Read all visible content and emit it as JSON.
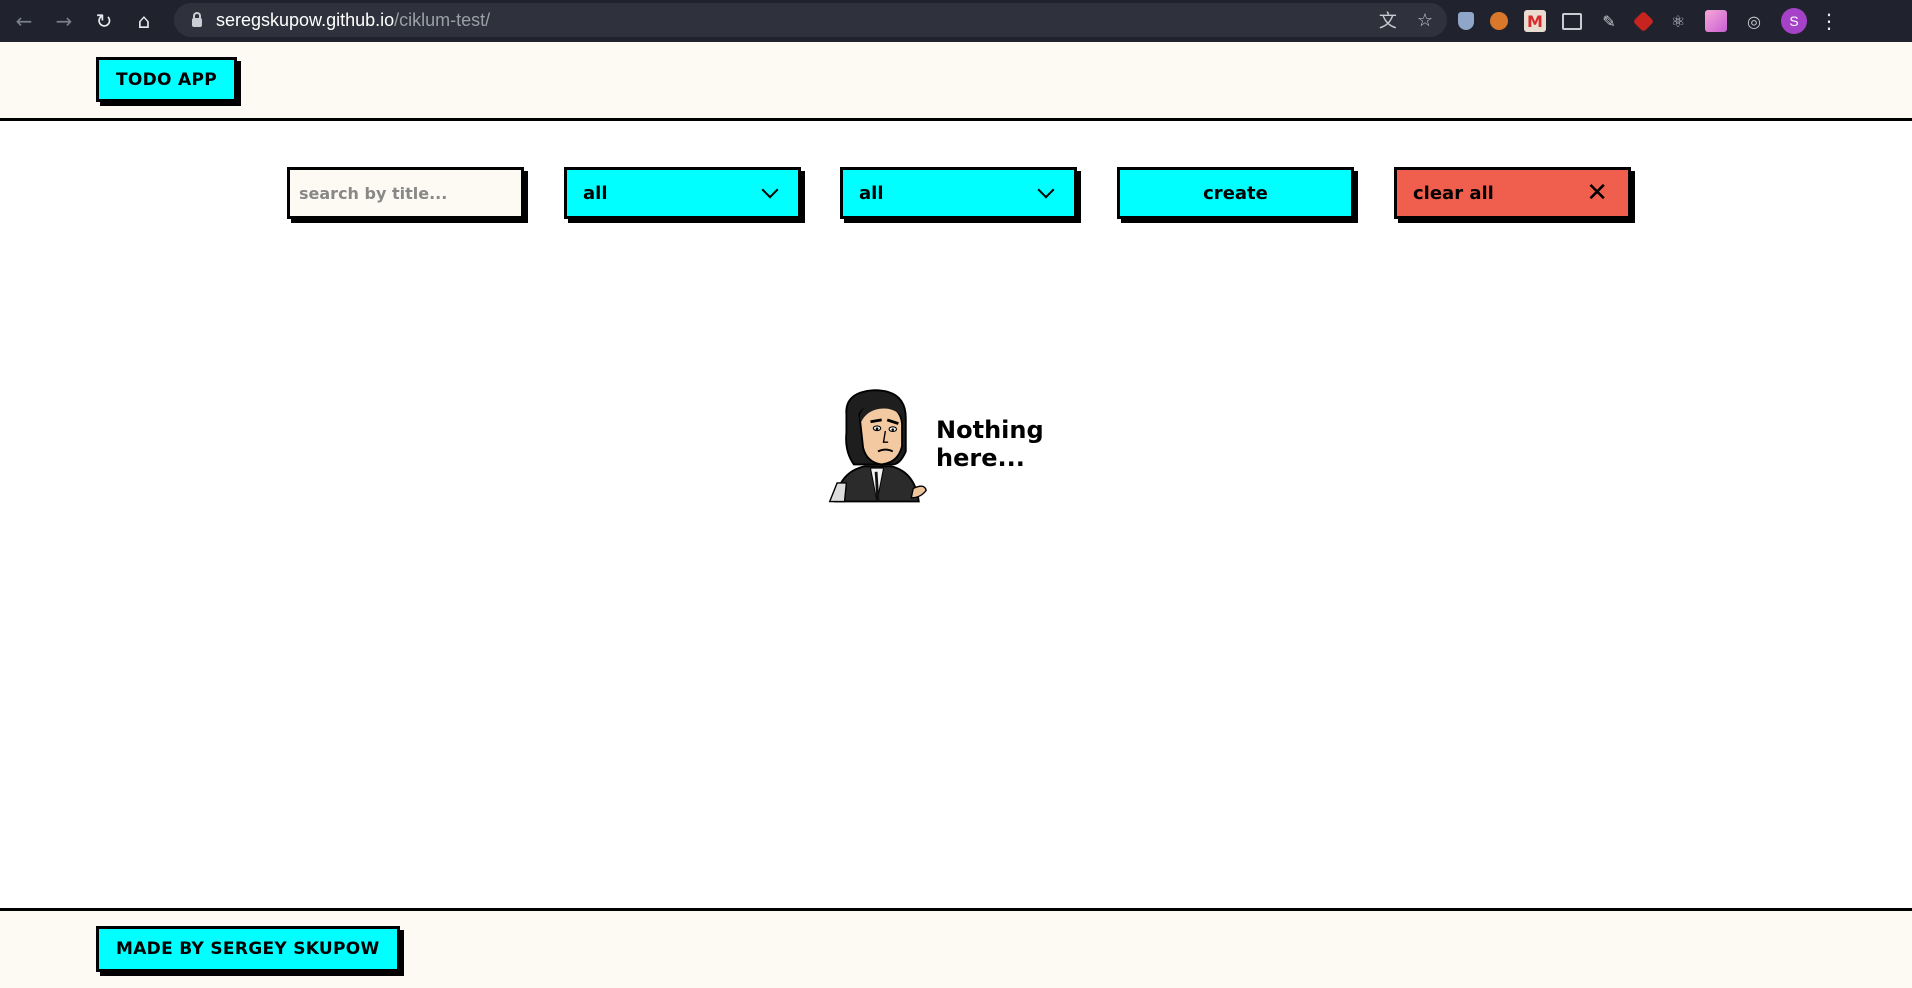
{
  "browser": {
    "url_host": "seregskupow.github.io",
    "url_path": "/ciklum-test/",
    "avatar_letter": "S",
    "icons": [
      "back-icon",
      "forward-icon",
      "reload-icon",
      "home-icon",
      "lock-icon",
      "translate-icon",
      "star-icon"
    ],
    "extensions": [
      "shield-extension-icon",
      "globe-extension-icon",
      "mcdonalds-extension-icon",
      "picture-in-picture-extension-icon",
      "pen-extension-icon",
      "ruby-extension-icon",
      "react-extension-icon",
      "gradient-extension-icon",
      "target-extension-icon"
    ]
  },
  "header": {
    "logo": "TODO APP"
  },
  "toolbar": {
    "search_placeholder": "search by title...",
    "filter_one": "all",
    "filter_two": "all",
    "create_label": "create",
    "clear_label": "clear all"
  },
  "main": {
    "empty_text": "Nothing here..."
  },
  "footer": {
    "credit": "MADE BY SERGEY SKUPOW"
  },
  "colors": {
    "accent": "#00ffff",
    "danger": "#f05f4e",
    "cream": "#fdf9f3",
    "chrome": "#20222e"
  }
}
